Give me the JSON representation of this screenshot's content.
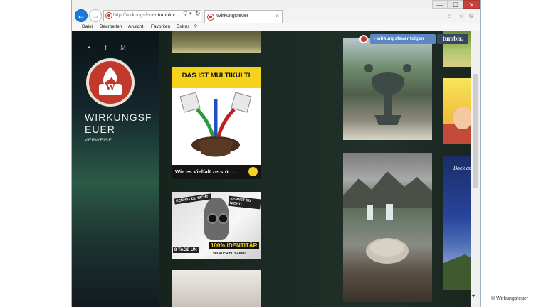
{
  "browser": {
    "address_prefix": "http://wirkungsfeuer.",
    "address_host": "tumblr.c...",
    "tab_title": "Wirkungsfeuer",
    "tab_close": "×",
    "minimize": "—",
    "restore": "☐",
    "close": "✕",
    "back": "←",
    "forward": "→",
    "search": "⚲",
    "dropdown": "▾",
    "refresh": "↻",
    "home": "⌂",
    "favorites": "☆",
    "tools": "⚙"
  },
  "menu": [
    "Datei",
    "Bearbeiten",
    "Ansicht",
    "Favoriten",
    "Extras",
    "?"
  ],
  "sidebar": {
    "social": [
      "▪",
      "f",
      "M"
    ],
    "logo_letter": "W",
    "title": "WIRKUNGSF EUER",
    "subtitle": "VERWEISE"
  },
  "tumblr": {
    "follow": "+ wirkungsfeuer folgen",
    "brand": "tumblr."
  },
  "posts": {
    "multikulti_title": "DAS IST MULTIKULTI",
    "multikulti_caption": "Wie es Vielfalt zerstört...",
    "identitaer_top_left": "KENNST DU NICHT!",
    "identitaer_top_right": "KENNST DU NICHT!",
    "identitaer_days": "8 TAGE UN",
    "identitaer_main": "100% IDENTITÄR",
    "identitaer_sub": "SEI AUCH DU DABEI!",
    "deutschland_title": "Bock auf Deutschland"
  },
  "scroll_arrow": "▾",
  "caption": "© Wirkungsfeuer",
  "colors": {
    "accent_red": "#c0392b",
    "follow_blue": "#5b87c5",
    "tumblr_navy": "#35475f",
    "multikulti_yellow": "#f5d31c"
  }
}
